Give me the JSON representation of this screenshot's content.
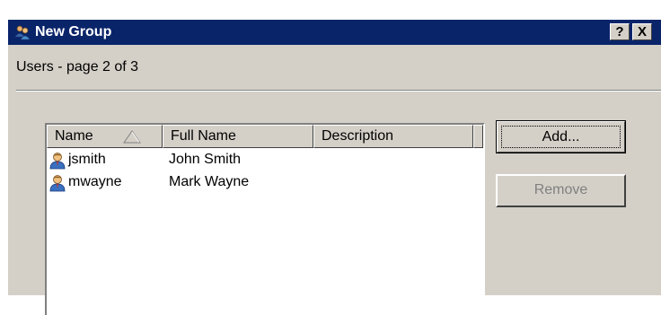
{
  "window": {
    "title": "New Group",
    "help_label": "?",
    "close_label": "X"
  },
  "page": {
    "subtitle": "Users - page 2 of 3"
  },
  "listview": {
    "columns": [
      "Name",
      "Full Name",
      "Description"
    ],
    "sort_column": "Name",
    "sort_direction": "ascending",
    "rows": [
      {
        "name": "jsmith",
        "full_name": "John Smith",
        "description": ""
      },
      {
        "name": "mwayne",
        "full_name": "Mark Wayne",
        "description": ""
      }
    ]
  },
  "buttons": {
    "add_label": "Add...",
    "remove_label": "Remove",
    "remove_enabled": false
  },
  "colors": {
    "titlebar": "#0a246a",
    "dialog_bg": "#d4d0c8",
    "disabled_text": "#808080"
  },
  "icons": {
    "title": "group-users-icon",
    "row": "user-icon",
    "sort": "sort-ascending-icon"
  }
}
